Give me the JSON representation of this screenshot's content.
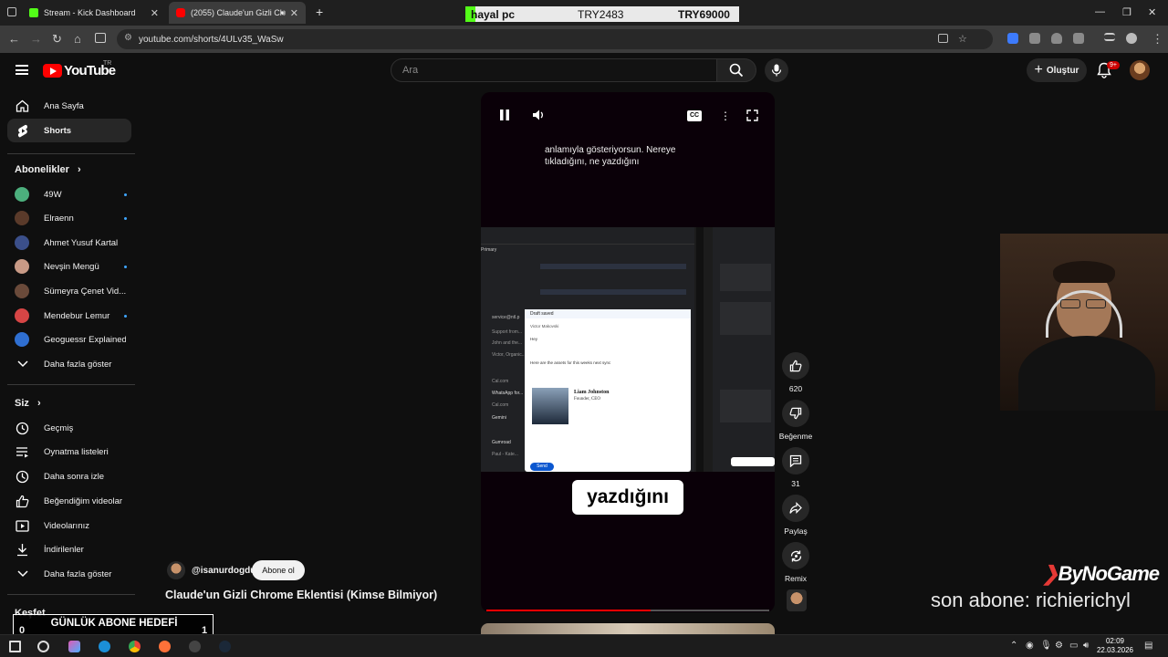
{
  "browser": {
    "tabs": [
      {
        "title": "Stream - Kick Dashboard",
        "favicon_color": "#53fc18"
      },
      {
        "title": "(2055) Claude'un Gizli Chro",
        "favicon_color": "#ff0000",
        "active": true
      }
    ],
    "url": "youtube.com/shorts/4ULv35_WaSw"
  },
  "stream_bar": {
    "name": "hayal pc",
    "current": "TRY2483",
    "goal": "TRY69000",
    "fill_fraction": 0.036
  },
  "header": {
    "logo_text": "YouTube",
    "region": "TR",
    "search_placeholder": "Ara",
    "create_label": "Oluştur",
    "notif_badge": "9+"
  },
  "sidebar": {
    "main": [
      {
        "label": "Ana Sayfa",
        "icon": "home-icon"
      },
      {
        "label": "Shorts",
        "icon": "shorts-icon",
        "active": true
      }
    ],
    "subs_header": "Abonelikler",
    "subscriptions": [
      {
        "label": "49W",
        "color": "#4caf7d",
        "dot": true
      },
      {
        "label": "Elraenn",
        "color": "#5a3a2a",
        "dot": true
      },
      {
        "label": "Ahmet Yusuf Kartal",
        "color": "#3b4f8a",
        "dot": false
      },
      {
        "label": "Nevşin Mengü",
        "color": "#c89a86",
        "dot": true
      },
      {
        "label": "Sümeyra Çenet Vid...",
        "color": "#6a4a3a",
        "dot": false
      },
      {
        "label": "Mendebur Lemur",
        "color": "#d64545",
        "dot": true
      },
      {
        "label": "Geoguessr Explained",
        "color": "#2f6fd1",
        "dot": false
      }
    ],
    "show_more": "Daha fazla göster",
    "you_header": "Siz",
    "you": [
      {
        "label": "Geçmiş",
        "icon": "history-icon"
      },
      {
        "label": "Oynatma listeleri",
        "icon": "playlist-icon"
      },
      {
        "label": "Daha sonra izle",
        "icon": "clock-icon"
      },
      {
        "label": "Beğendiğim videolar",
        "icon": "thumbs-up-icon"
      },
      {
        "label": "Videolarınız",
        "icon": "video-icon"
      },
      {
        "label": "İndirilenler",
        "icon": "download-icon"
      }
    ],
    "you_more": "Daha fazla göster",
    "explore_header": "Keşfet"
  },
  "player": {
    "subtitle_top": "anlamıyla gösteriyorsun. Nereye tıkladığını, ne yazdığını",
    "caption": "yazdığını",
    "progress": 0.58,
    "email": {
      "draft": "Draft saved",
      "to": "Victor Makovski",
      "hey": "Hey",
      "body": "Here are the assets for this weeks next sync",
      "sig_name": "Liam Johnston",
      "sig_role": "Founder, CEO",
      "send": "Send",
      "sidebar_items": [
        "Primary",
        "service@ntl.p",
        "Support from...",
        "John and the...",
        "Victor, Organic...",
        "Cal.com",
        "WhatsApp for...",
        "Cal.com",
        "Gemini",
        "Gumroad",
        "Paul - Kate..."
      ]
    }
  },
  "actions": {
    "likes": "620",
    "dislike": "Beğenme",
    "comments": "31",
    "share": "Paylaş",
    "remix": "Remix"
  },
  "channel": {
    "handle": "@isanurdogdu",
    "subscribe": "Abone ol",
    "title": "Claude'un Gizli Chrome Eklentisi (Kimse Bilmiyor)"
  },
  "stream_overlay": {
    "brand": "ByNoGame",
    "last_sub": "son abone: richierichyl",
    "goal_title": "GÜNLÜK ABONE HEDEFİ",
    "goal_current": "0",
    "goal_target": "1"
  },
  "taskbar": {
    "time": "02:09",
    "date": "22.03.2026"
  }
}
